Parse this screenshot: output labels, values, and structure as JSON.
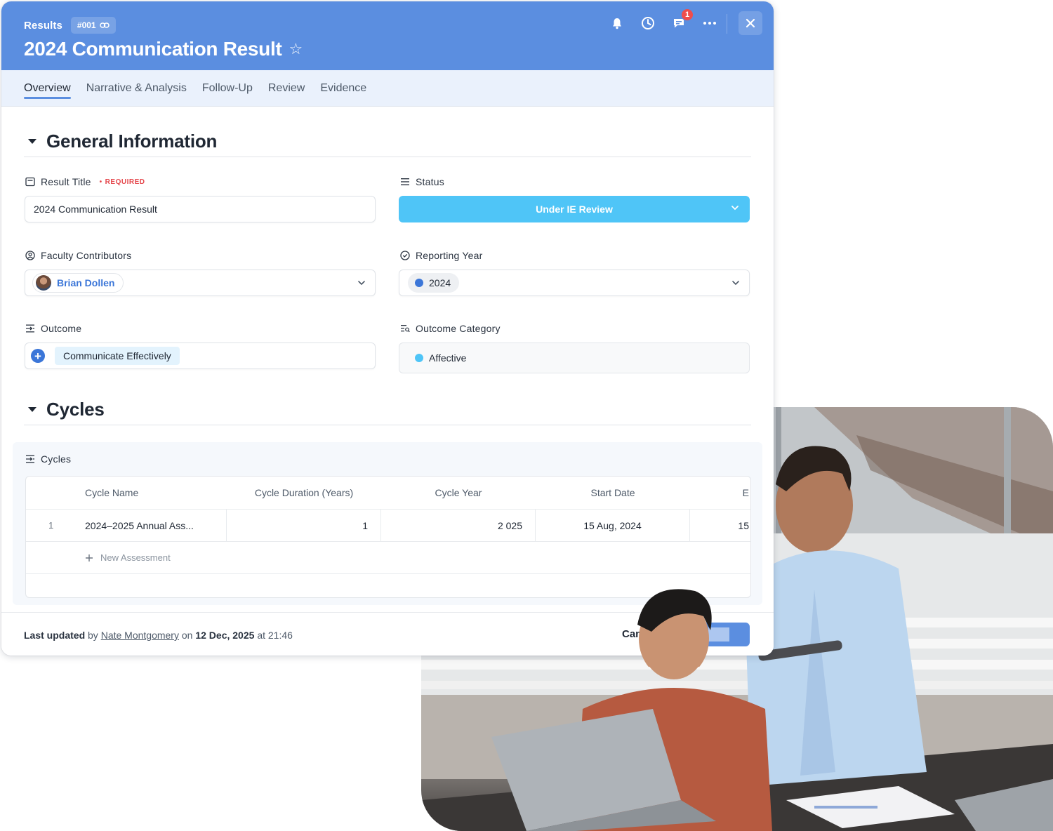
{
  "header": {
    "breadcrumb": "Results",
    "record_id": "#001",
    "title": "2024 Communication Result",
    "notifications_count": "1"
  },
  "tabs": [
    {
      "label": "Overview",
      "active": true
    },
    {
      "label": "Narrative & Analysis"
    },
    {
      "label": "Follow-Up"
    },
    {
      "label": "Review"
    },
    {
      "label": "Evidence"
    }
  ],
  "general": {
    "section_title": "General Information",
    "result_title": {
      "label": "Result Title",
      "required": "REQUIRED",
      "value": "2024 Communication Result"
    },
    "status": {
      "label": "Status",
      "value": "Under IE Review",
      "color": "#4fc5f7"
    },
    "faculty": {
      "label": "Faculty Contributors",
      "person": "Brian Dollen"
    },
    "reporting_year": {
      "label": "Reporting Year",
      "value": "2024",
      "dot_color": "#3b76d8"
    },
    "outcome": {
      "label": "Outcome",
      "value": "Communicate Effectively"
    },
    "outcome_category": {
      "label": "Outcome Category",
      "value": "Affective",
      "dot_color": "#4fc5f7"
    }
  },
  "cycles": {
    "section_title": "Cycles",
    "panel_label": "Cycles",
    "columns": [
      "Cycle Name",
      "Cycle Duration (Years)",
      "Cycle Year",
      "Start Date",
      "E"
    ],
    "rows": [
      {
        "index": "1",
        "name": "2024–2025 Annual Ass...",
        "duration": "1",
        "year": "2 025",
        "start": "15 Aug, 2024",
        "end": "15"
      }
    ],
    "new_label": "New Assessment"
  },
  "footer": {
    "prefix": "Last updated",
    "by": "by",
    "user": "Nate Montgomery",
    "on": "on",
    "date": "12 Dec, 2025",
    "at": "at",
    "time": "21:46",
    "cancel_label": "Canc",
    "save_label": "ve"
  },
  "colors": {
    "brand": "#5b8ee0",
    "tab_bar": "#eaf1fc",
    "accent": "#3b76d8"
  }
}
